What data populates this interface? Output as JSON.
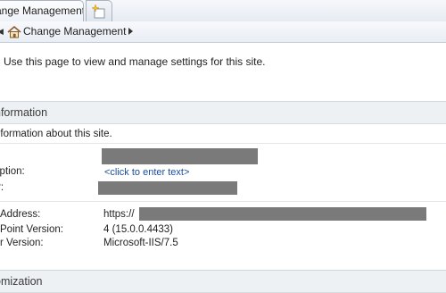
{
  "tab": {
    "active_label": "ange Management"
  },
  "breadcrumb": {
    "items": [
      "Change Management"
    ]
  },
  "intro_text": "Use this page to view and manage settings for this site.",
  "sections": {
    "information": {
      "title": "nformation",
      "description": "nformation about this site."
    },
    "customization": {
      "title": "omization"
    }
  },
  "fields": {
    "description": {
      "label": "iption:",
      "link": "<click to enter text>"
    },
    "owner": {
      "label": "r:"
    },
    "address": {
      "label": "Address:",
      "value": "https://"
    },
    "sharepoint_version": {
      "label": "Point Version:",
      "value": "4 (15.0.0.4433)"
    },
    "server_version": {
      "label": "r Version:",
      "value": "Microsoft-IIS/7.5"
    }
  },
  "icons": {
    "new_tab": "new-tab-icon",
    "home": "home-icon",
    "breadcrumb_arrow": "chevron-right-icon"
  }
}
